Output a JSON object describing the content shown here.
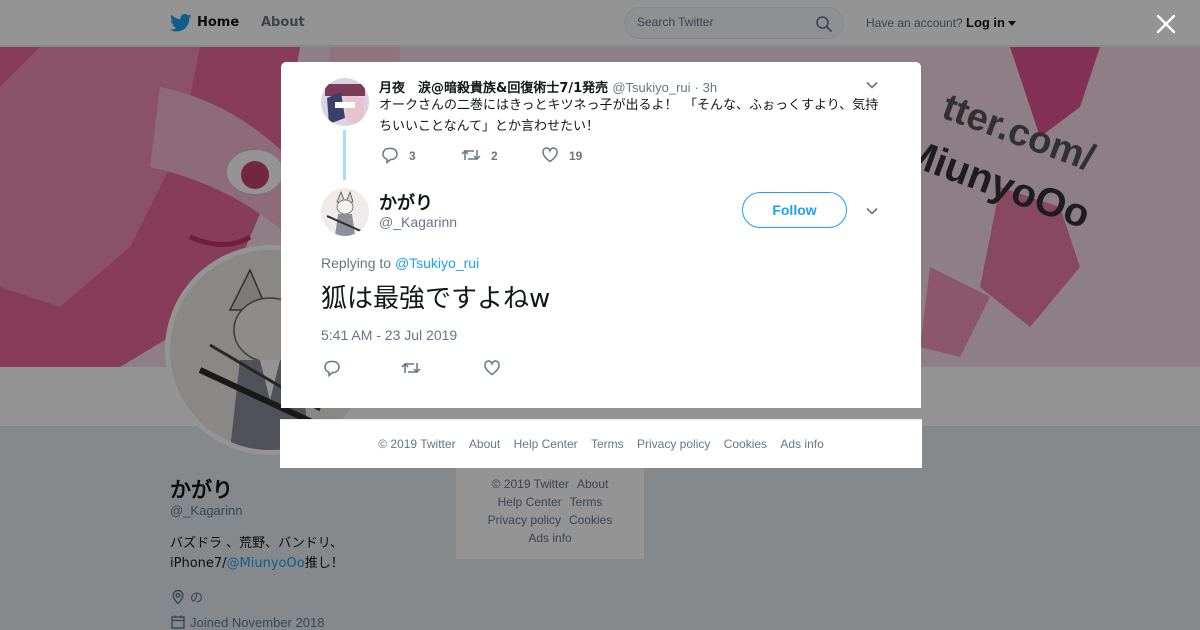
{
  "nav": {
    "home_label": "Home",
    "about_label": "About",
    "search_placeholder": "Search Twitter",
    "have_account": "Have an account?",
    "login_label": "Log in",
    "brand_color": "#1da1f2"
  },
  "profile": {
    "name": "かがり",
    "handle": "@_Kagarinn",
    "bio_prefix": "バズドラ 、荒野、バンドリ、iPhone7/",
    "bio_mention": "@MiunyoOo",
    "bio_suffix": "推し！",
    "location": "の",
    "joined": "Joined November 2018",
    "banner_text_1": "tter.com/",
    "banner_text_2": "MiunyoOo"
  },
  "side_footer": {
    "links": [
      "© 2019 Twitter",
      "About",
      "Help Center",
      "Terms",
      "Privacy policy",
      "Cookies",
      "Ads info"
    ]
  },
  "modal": {
    "parent_tweet": {
      "name": "月夜　涙@暗殺貴族&回復術士7/1発売",
      "handle": "@Tsukiyo_rui",
      "time": "· 3h",
      "text": "オークさんの二巻にはきっとキツネっ子が出るよ！　「そんな、ふぉっくすより、気持ちいいことなんて」とか言わせたい！",
      "reply_count": "3",
      "retweet_count": "2",
      "like_count": "19"
    },
    "main_tweet": {
      "name": "かがり",
      "handle": "@_Kagarinn",
      "follow_label": "Follow",
      "replying_prefix": "Replying to",
      "replying_to": "@Tsukiyo_rui",
      "text": "狐は最強ですよねw",
      "timestamp": "5:41 AM - 23 Jul 2019"
    },
    "footer_links": [
      "© 2019 Twitter",
      "About",
      "Help Center",
      "Terms",
      "Privacy policy",
      "Cookies",
      "Ads info"
    ]
  },
  "icons": {
    "logo": "twitter-bird-icon",
    "search": "search-icon",
    "close": "close-icon",
    "reply": "reply-icon",
    "retweet": "retweet-icon",
    "like": "heart-icon",
    "more": "chevron-down-icon",
    "location": "location-pin-icon",
    "calendar": "calendar-icon"
  }
}
